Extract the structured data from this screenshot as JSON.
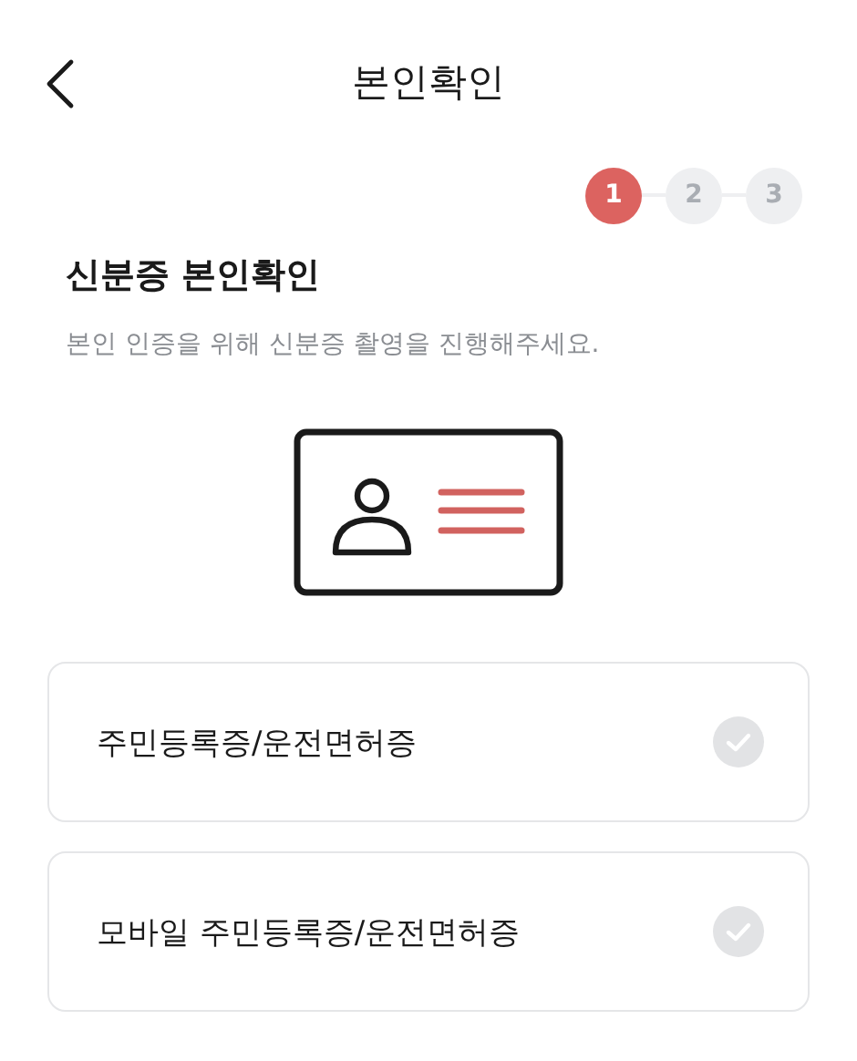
{
  "header": {
    "title": "본인확인"
  },
  "steps": [
    {
      "label": "1",
      "selected": true
    },
    {
      "label": "2",
      "selected": false
    },
    {
      "label": "3",
      "selected": false
    }
  ],
  "heading": "신분증 본인확인",
  "description": "본인 인증을 위해 신분증 촬영을 진행해주세요.",
  "options": [
    {
      "label": "주민등록증/운전면허증",
      "selected": false
    },
    {
      "label": "모바일 주민등록증/운전면허증",
      "selected": false
    }
  ]
}
